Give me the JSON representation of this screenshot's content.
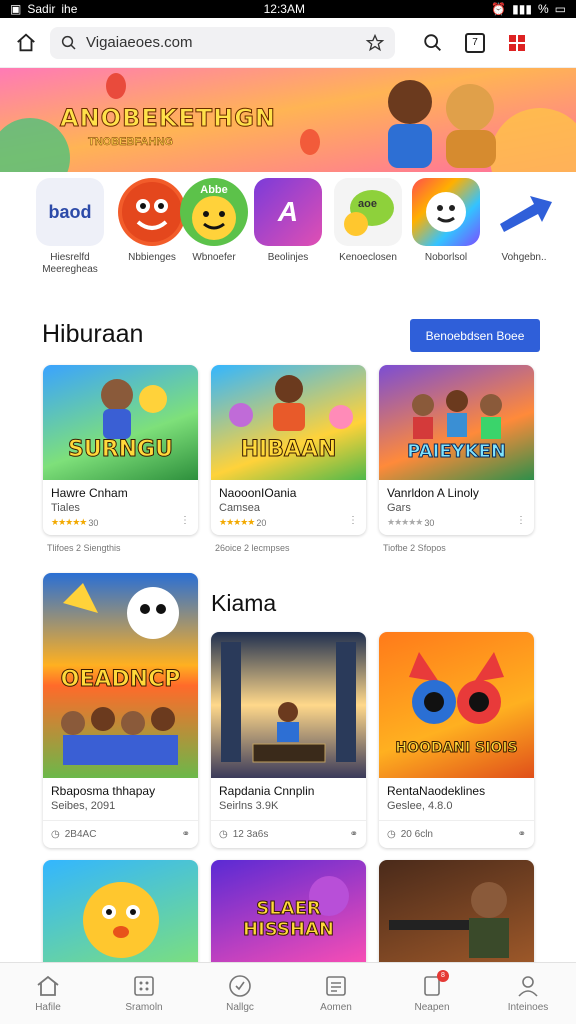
{
  "status_bar": {
    "carrier": "Sadir",
    "label": "ihe",
    "time": "12:3AM",
    "battery": "%"
  },
  "browser": {
    "url": "Vigaiaeoes.com",
    "tab_count": "7"
  },
  "banner": {
    "title": "ANOBEKETHGN",
    "subtitle": "TNOBEBFAHNG"
  },
  "apps": [
    {
      "label": "Hiesrelfd Meeregheas",
      "icon_text": "baod"
    },
    {
      "label": "Nbbienges",
      "icon_text": ""
    },
    {
      "label": "Wbnoefer",
      "icon_text": "Abbe"
    },
    {
      "label": "Beolinjes",
      "icon_text": "A"
    },
    {
      "label": "Kenoeclosen",
      "icon_text": "aoe"
    },
    {
      "label": "Noborlsol",
      "icon_text": ""
    },
    {
      "label": "Vohgebn..",
      "icon_text": ""
    }
  ],
  "section1": {
    "title": "Hiburaan",
    "button": "Benoebdsen Boee"
  },
  "section1_cards": [
    {
      "img_text": "SURNGU",
      "title": "Hawre Cnham",
      "sub": "Tiales",
      "rating": "30",
      "meta": "Tlifoes 2 Siengthis"
    },
    {
      "img_text": "HIBAAN",
      "title": "NaooonIOania",
      "sub": "Camsea",
      "rating": "20",
      "meta": "26oice 2 lecmpses"
    },
    {
      "img_text": "PAIEYKEN",
      "title": "Vanrldon A Linoly",
      "sub": "Gars",
      "rating": "30",
      "meta": "Tiofbe 2 Sfopos"
    }
  ],
  "section2": {
    "title": "Kiama"
  },
  "section2_cards": [
    {
      "img_text": "OEADNCP",
      "title": "Rbaposma thhapay",
      "sub": "Seibes, 2091",
      "footer": "2B4AC"
    },
    {
      "img_text": "",
      "title": "Rapdania Cnnplin",
      "sub": "Seirlns 3.9K",
      "footer": "12 3a6s"
    },
    {
      "img_text": "HOODANI SIOIS",
      "title": "RentaNaodeklines",
      "sub": "Geslee, 4.8.0",
      "footer": "20 6cln"
    }
  ],
  "section3_cards": [
    {
      "img_text": ""
    },
    {
      "img_text": "SLAER HISSHAN"
    },
    {
      "img_text": ""
    }
  ],
  "bottom_nav": [
    {
      "label": "Hafile"
    },
    {
      "label": "Sramoln"
    },
    {
      "label": "Nallgc"
    },
    {
      "label": "Aomen"
    },
    {
      "label": "Neapen",
      "badge": "8"
    },
    {
      "label": "Inteinoes"
    }
  ],
  "colors": {
    "accent": "#2f5fd9",
    "badge": "#e53935",
    "star": "#f2a900"
  }
}
